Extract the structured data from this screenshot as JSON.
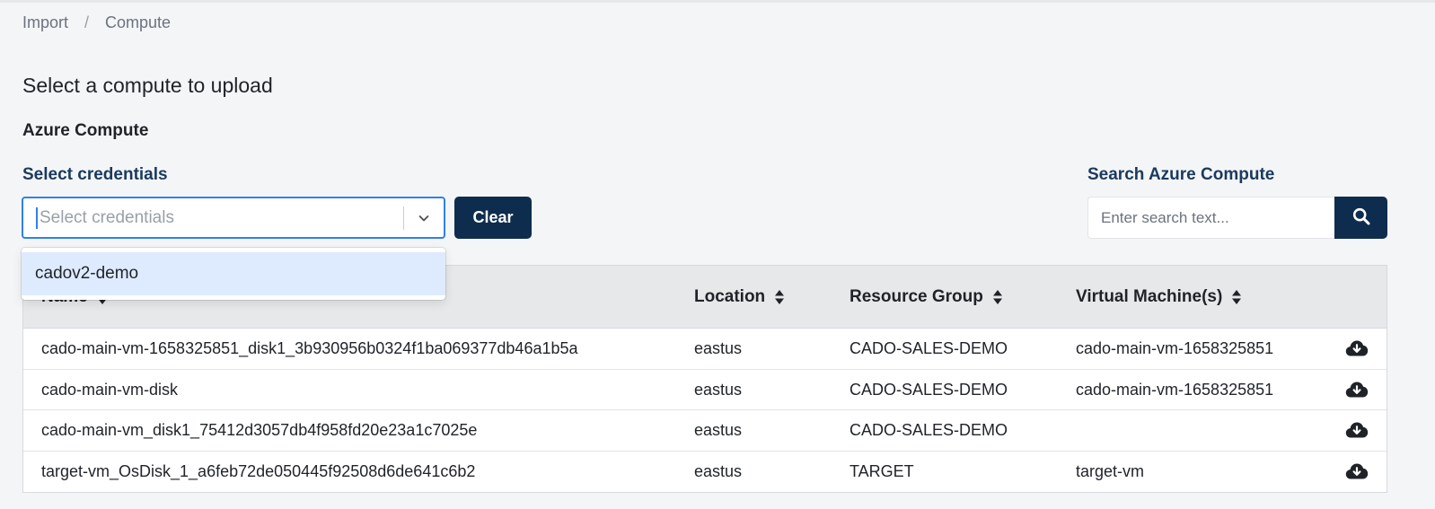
{
  "breadcrumb": {
    "items": [
      "Import",
      "Compute"
    ],
    "separator": "/"
  },
  "page_title": "Select a compute to upload",
  "section_title": "Azure Compute",
  "credentials": {
    "label": "Select credentials",
    "placeholder": "Select credentials",
    "options": [
      "cadov2-demo"
    ],
    "clear_label": "Clear"
  },
  "search": {
    "label": "Search Azure Compute",
    "placeholder": "Enter search text..."
  },
  "table": {
    "columns": [
      "Name",
      "Location",
      "Resource Group",
      "Virtual Machine(s)"
    ],
    "rows": [
      {
        "name": "cado-main-vm-1658325851_disk1_3b930956b0324f1ba069377db46a1b5a",
        "location": "eastus",
        "resource_group": "CADO-SALES-DEMO",
        "vm": "cado-main-vm-1658325851"
      },
      {
        "name": "cado-main-vm-disk",
        "location": "eastus",
        "resource_group": "CADO-SALES-DEMO",
        "vm": "cado-main-vm-1658325851"
      },
      {
        "name": "cado-main-vm_disk1_75412d3057db4f958fd20e23a1c7025e",
        "location": "eastus",
        "resource_group": "CADO-SALES-DEMO",
        "vm": ""
      },
      {
        "name": "target-vm_OsDisk_1_a6feb72de050445f92508d6de641c6b2",
        "location": "eastus",
        "resource_group": "TARGET",
        "vm": "target-vm"
      }
    ]
  },
  "colors": {
    "primary": "#0e2d4e",
    "label": "#1a3a5e",
    "focus": "#2f80ed",
    "option_highlight": "#deebff"
  },
  "icons": {
    "dropdown": "chevron-down-icon",
    "search": "search-icon",
    "sort": "sort-icon",
    "row_action": "cloud-download-icon"
  }
}
